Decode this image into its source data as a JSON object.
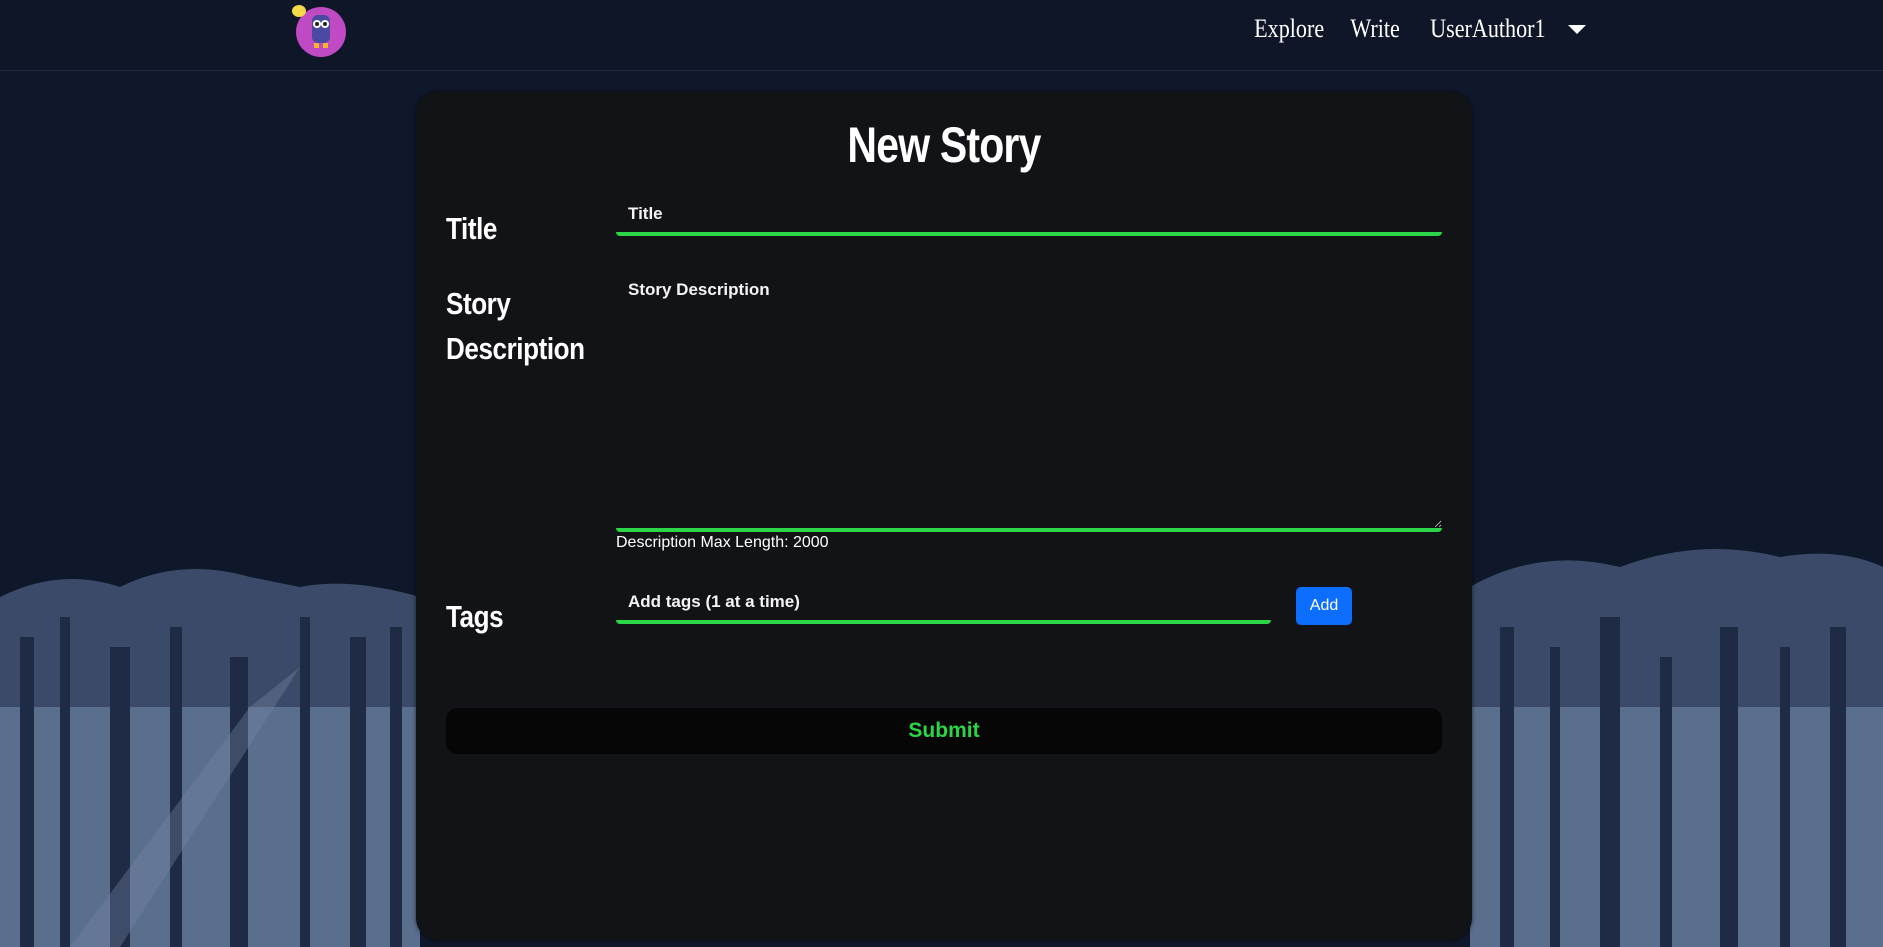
{
  "nav": {
    "links": [
      "Explore",
      "Write",
      "UserAuthor1"
    ]
  },
  "form": {
    "heading": "New Story",
    "title_label": "Title",
    "title_placeholder": "Title",
    "title_value": "",
    "description_label_line1": "Story",
    "description_label_line2": "Description",
    "description_placeholder": "Story Description",
    "description_value": "",
    "description_hint": "Description Max Length: 2000",
    "tags_label": "Tags",
    "tags_placeholder": "Add tags (1 at a time)",
    "tags_value": "",
    "add_label": "Add",
    "submit_label": "Submit"
  },
  "colors": {
    "accent": "#2bd548",
    "primary_button": "#0d6efd",
    "card": "#121317",
    "page": "#0f172a"
  },
  "icons": {
    "logo": "owl-logo-icon",
    "user_menu": "caret-down-icon"
  }
}
